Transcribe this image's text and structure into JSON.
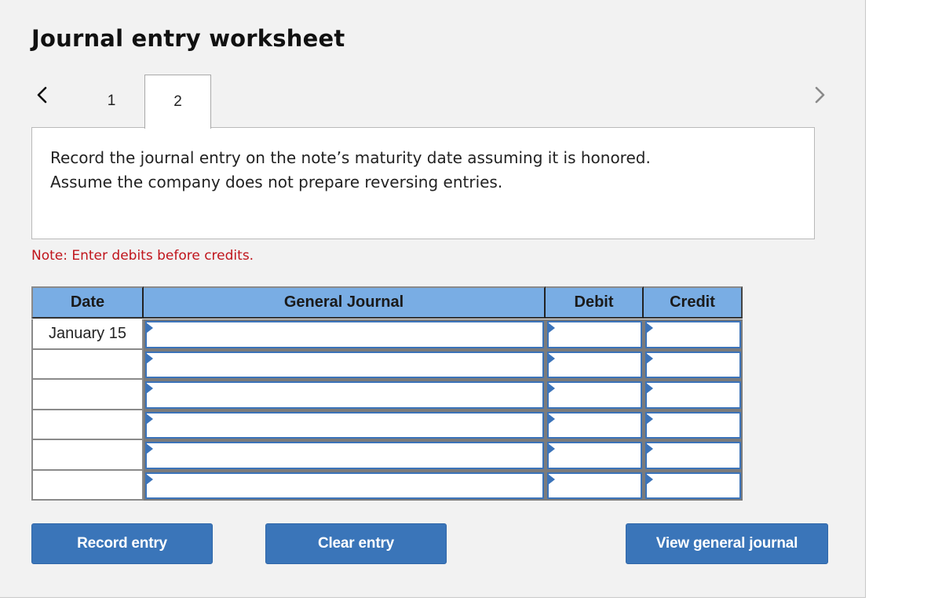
{
  "title": "Journal entry worksheet",
  "nav": {
    "prev_icon": "chevron-left-icon",
    "next_icon": "chevron-right-icon",
    "tabs": [
      {
        "label": "1",
        "active": false
      },
      {
        "label": "2",
        "active": true
      }
    ]
  },
  "instruction": {
    "line1": "Record the journal entry on the note’s maturity date assuming it is honored.",
    "line2": "Assume the company does not prepare reversing entries."
  },
  "note": "Note: Enter debits before credits.",
  "table": {
    "headers": {
      "date": "Date",
      "general_journal": "General Journal",
      "debit": "Debit",
      "credit": "Credit"
    },
    "rows": [
      {
        "date": "January 15",
        "account": "",
        "debit": "",
        "credit": ""
      },
      {
        "date": "",
        "account": "",
        "debit": "",
        "credit": ""
      },
      {
        "date": "",
        "account": "",
        "debit": "",
        "credit": ""
      },
      {
        "date": "",
        "account": "",
        "debit": "",
        "credit": ""
      },
      {
        "date": "",
        "account": "",
        "debit": "",
        "credit": ""
      },
      {
        "date": "",
        "account": "",
        "debit": "",
        "credit": ""
      }
    ]
  },
  "buttons": {
    "record": "Record entry",
    "clear": "Clear entry",
    "view": "View general journal"
  },
  "colors": {
    "header_bg": "#79ade4",
    "button_bg": "#3a75b9",
    "note_text": "#c0141b",
    "input_border": "#3b73b9"
  }
}
